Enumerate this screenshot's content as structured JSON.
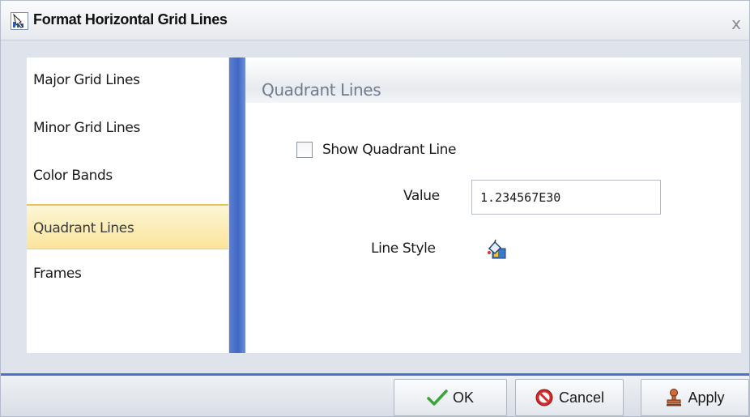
{
  "dialog": {
    "title": "Format Horizontal Grid Lines",
    "close_label": "x",
    "title_icon": "chart-format-icon"
  },
  "nav": {
    "items": [
      {
        "label": "Major Grid Lines",
        "selected": false
      },
      {
        "label": "Minor Grid Lines",
        "selected": false
      },
      {
        "label": "Color Bands",
        "selected": false
      },
      {
        "label": "Quadrant Lines",
        "selected": true
      },
      {
        "label": "Frames",
        "selected": false
      }
    ]
  },
  "section": {
    "title": "Quadrant Lines",
    "show_quadrant_line_label": "Show Quadrant Line",
    "show_quadrant_line_checked": false,
    "value_label": "Value",
    "value": "1.234567E30",
    "line_style_label": "Line Style",
    "line_style_icon": "paint-bucket-icon"
  },
  "buttons": {
    "ok_label": "OK",
    "cancel_label": "Cancel",
    "apply_label": "Apply"
  },
  "colors": {
    "accent": "#4b72c9",
    "selected_item": "#fbe49b",
    "section_title": "#707c8c"
  }
}
